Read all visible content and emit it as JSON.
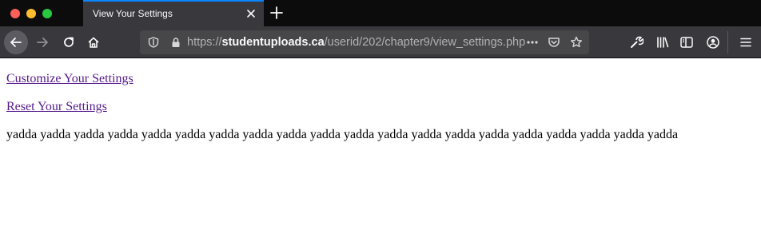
{
  "browser": {
    "tab": {
      "title": "View Your Settings"
    },
    "url": {
      "scheme": "https://",
      "host": "studentuploads.ca",
      "path": "/userid/202/chapter9/view_settings.php"
    },
    "icons": {
      "back": "back-arrow-icon",
      "forward": "forward-arrow-icon",
      "reload": "reload-icon",
      "home": "home-icon",
      "shield": "tracking-shield-icon",
      "lock": "lock-icon",
      "more": "more-actions-icon",
      "pocket": "pocket-icon",
      "bookmark": "bookmark-star-icon",
      "devtools": "wrench-icon",
      "library": "library-icon",
      "sidebar": "sidebar-icon",
      "account": "account-icon",
      "menu": "hamburger-menu-icon"
    },
    "colors": {
      "tab_accent": "#0a84ff",
      "toolbar": "#38383d",
      "tabstrip": "#0c0c0d",
      "link_visited": "#551a8b"
    }
  },
  "page": {
    "links": [
      {
        "label": "Customize Your Settings"
      },
      {
        "label": "Reset Your Settings"
      }
    ],
    "body_text": "yadda yadda yadda yadda yadda yadda yadda yadda yadda yadda yadda yadda yadda yadda yadda yadda yadda yadda yadda yadda"
  }
}
